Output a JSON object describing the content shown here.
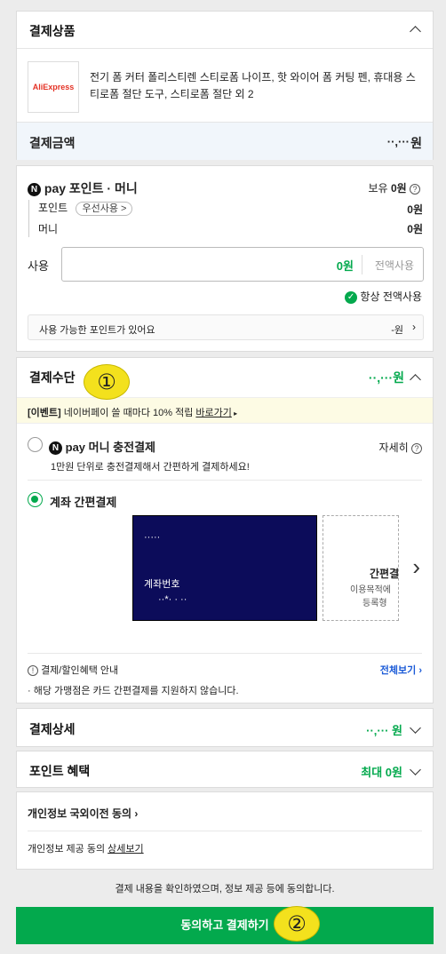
{
  "product": {
    "header": "결제상품",
    "logo": "AliExpress",
    "description": "전기 폼 커터 폴리스티렌 스티로폼 나이프, 핫 와이어 폼 커팅 펜, 휴대용 스티로폼 절단 도구, 스티로폼 절단 외 2",
    "amount_label": "결제금액",
    "amount_value": "··,···",
    "amount_unit": "원"
  },
  "points": {
    "title": "pay 포인트 · 머니",
    "n_badge": "N",
    "balance_label": "보유",
    "balance_value": "0원",
    "rows": [
      {
        "label": "포인트",
        "tag": "우선사용",
        "value": "0원"
      },
      {
        "label": "머니",
        "value": "0원"
      }
    ],
    "use_label": "사용",
    "use_value": "0원",
    "use_all_button": "전액사용",
    "always_use": "항상 전액사용",
    "available_banner": "사용 가능한 포인트가 있어요",
    "available_value": "-원"
  },
  "payment_method": {
    "title": "결제수단",
    "amount": "··,···",
    "amount_unit": "원",
    "event_tag": "[이벤트]",
    "event_text": "네이버페이 쓸 때마다 10% 적립",
    "event_link": "바로가기",
    "option1_title": "pay 머니 충전결제",
    "option1_detail": "자세히",
    "option1_desc": "1만원 단위로 충전결제해서 간편하게 결제하세요!",
    "option2_title": "계좌 간편결제",
    "card_bank": "·····",
    "card_account_label": "계좌번호",
    "card_account_number": "··*·  ·  ··",
    "add_title": "간편결",
    "add_line1": "이용목적에",
    "add_line2": "등록형",
    "benefit_label": "결제/할인혜택 안내",
    "benefit_all": "전체보기",
    "benefit_note": "· 해당 가맹점은 카드 간편결제를 지원하지 않습니다."
  },
  "detail": {
    "title": "결제상세",
    "amount": "··,···",
    "unit": "원"
  },
  "benefit": {
    "title": "포인트 혜택",
    "value": "최대 0원"
  },
  "privacy": {
    "title": "개인정보 국외이전 동의",
    "provide_text": "개인정보 제공 동의",
    "provide_link": "상세보기"
  },
  "agree_text": "결제 내용을 확인하였으며, 정보 제공 등에 동의합니다.",
  "pay_button": "동의하고 결제하기",
  "markers": [
    "①",
    "②"
  ]
}
